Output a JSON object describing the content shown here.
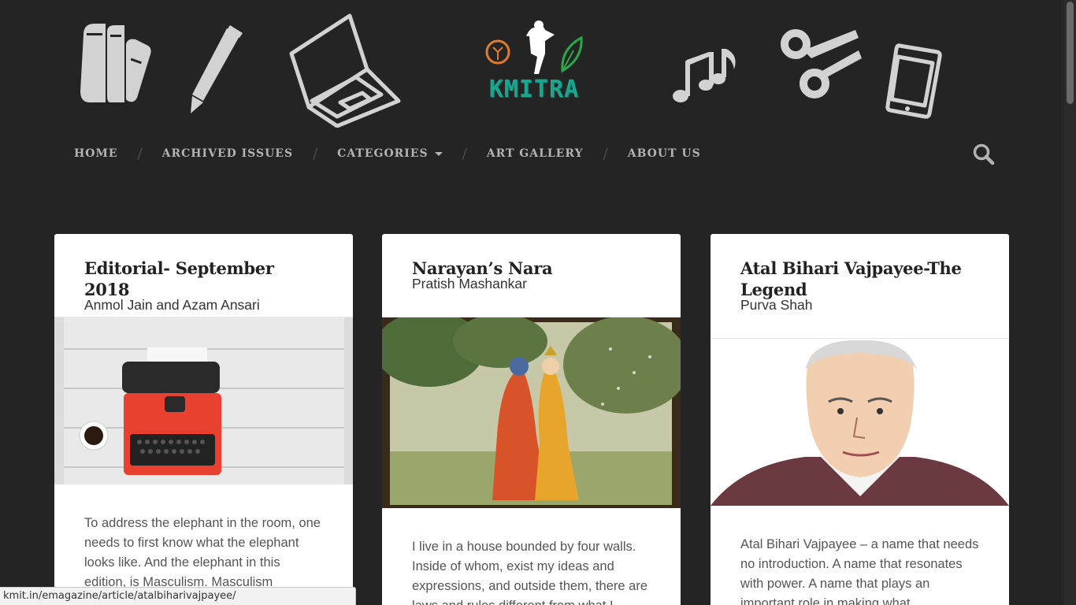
{
  "header": {
    "icons": [
      "books-icon",
      "pen-icon",
      "laptop-icon",
      "music-notes-icon",
      "scissors-icon",
      "smartphone-icon"
    ],
    "logo_text": "KMITRA"
  },
  "nav": {
    "items": [
      {
        "label": "HOME"
      },
      {
        "label": "ARCHIVED ISSUES"
      },
      {
        "label": "CATEGORIES"
      },
      {
        "label": "ART GALLERY"
      },
      {
        "label": "ABOUT US"
      }
    ],
    "separator": "/",
    "search_icon": "search-icon"
  },
  "articles": [
    {
      "title": "Editorial- September 2018",
      "author": "Anmol Jain and Azam Ansari",
      "image": "typewriter-editorial-image",
      "excerpt": "To address the elephant in the room, one needs to first know what the elephant looks like. And the elephant in this edition, is Masculism. Masculism"
    },
    {
      "title": "Narayan’s Nara",
      "author": "Pratish Mashankar",
      "image": "krishna-radha-painting-image",
      "excerpt": "I live in a house bounded by four walls. Inside of whom, exist my ideas and expressions, and outside them, there are laws and rules different from what I"
    },
    {
      "title": "Atal Bihari Vajpayee-The Legend",
      "author": "Purva Shah",
      "image": "vajpayee-portrait-image",
      "excerpt": "Atal Bihari Vajpayee – a name that needs no introduction. A name that resonates with power. A name that plays an important role in making what"
    }
  ],
  "statusbar": {
    "url": "kmit.in/emagazine/article/atalbiharivajpayee/"
  },
  "colors": {
    "background": "#242424",
    "nav_text": "#b3b3b3",
    "logo_teal": "#1aa58f",
    "card_bg": "#ffffff"
  }
}
